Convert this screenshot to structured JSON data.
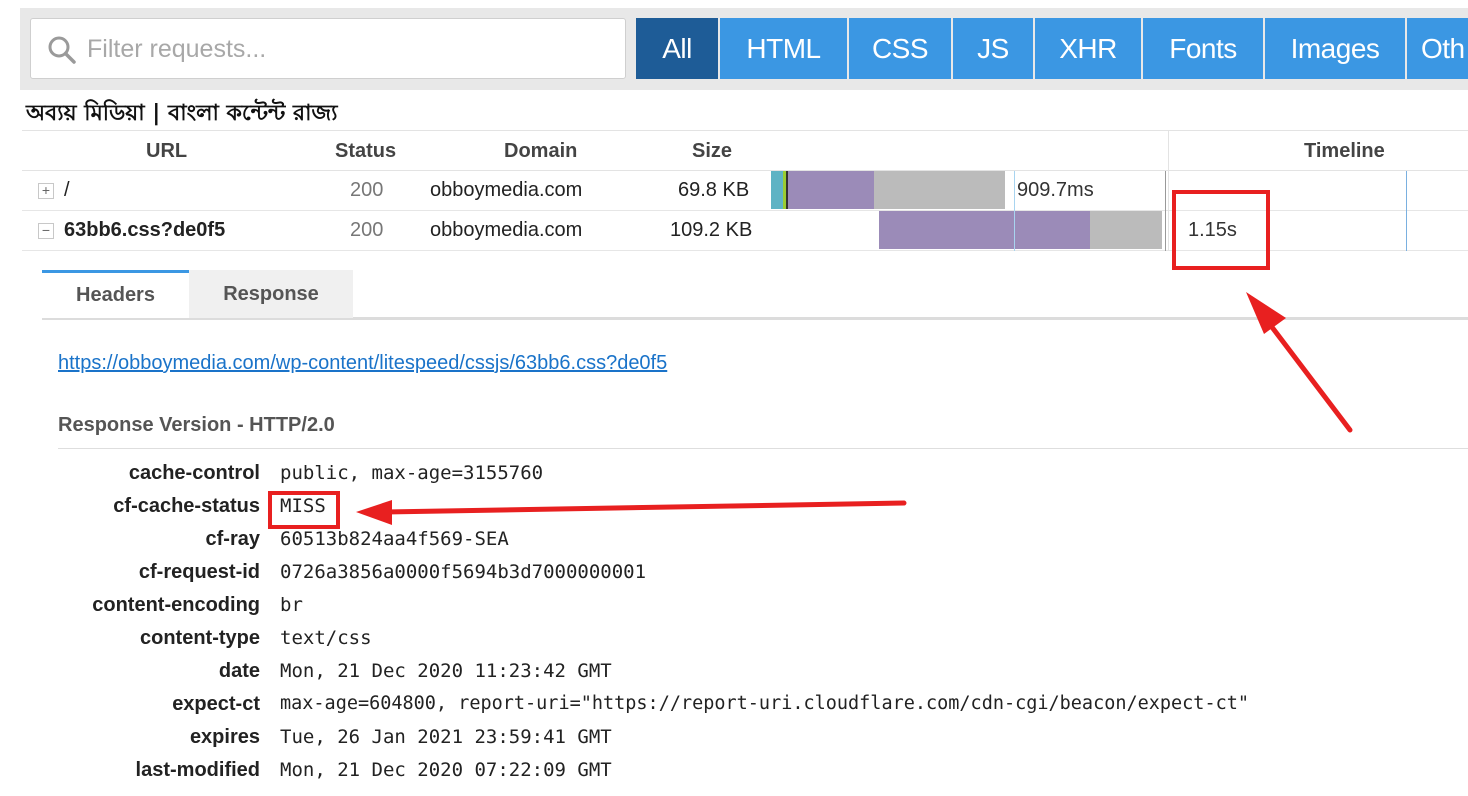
{
  "filter": {
    "placeholder": "Filter requests...",
    "search_icon": "search-icon",
    "types": [
      "All",
      "HTML",
      "CSS",
      "JS",
      "XHR",
      "Fonts",
      "Images",
      "Oth"
    ],
    "active_type": "All"
  },
  "page_title": "অব্যয় মিডিয়া | বাংলা কন্টেন্ট রাজ্য",
  "table": {
    "columns": {
      "url": "URL",
      "status": "Status",
      "domain": "Domain",
      "size": "Size",
      "timeline": "Timeline"
    },
    "rows": [
      {
        "toggle": "+",
        "url": "/",
        "status": "200",
        "domain": "obboymedia.com",
        "size": "69.8 KB",
        "time": "909.7ms"
      },
      {
        "toggle": "−",
        "url": "63bb6.css?de0f5",
        "status": "200",
        "domain": "obboymedia.com",
        "size": "109.2 KB",
        "time": "1.15s"
      }
    ]
  },
  "details": {
    "tabs": [
      "Headers",
      "Response"
    ],
    "active_tab": "Headers",
    "url": "https://obboymedia.com/wp-content/litespeed/cssjs/63bb6.css?de0f5",
    "response_version": "Response Version - HTTP/2.0",
    "headers": [
      {
        "name": "cache-control",
        "value": "public, max-age=3155760"
      },
      {
        "name": "cf-cache-status",
        "value": "MISS"
      },
      {
        "name": "cf-ray",
        "value": "60513b824aa4f569-SEA"
      },
      {
        "name": "cf-request-id",
        "value": "0726a3856a0000f5694b3d7000000001"
      },
      {
        "name": "content-encoding",
        "value": "br"
      },
      {
        "name": "content-type",
        "value": "text/css"
      },
      {
        "name": "date",
        "value": "Mon, 21 Dec 2020 11:23:42 GMT"
      },
      {
        "name": "expect-ct",
        "value": "max-age=604800, report-uri=\"https://report-uri.cloudflare.com/cdn-cgi/beacon/expect-ct\""
      },
      {
        "name": "expires",
        "value": "Tue, 26 Jan 2021 23:59:41 GMT"
      },
      {
        "name": "last-modified",
        "value": "Mon, 21 Dec 2020 07:22:09 GMT"
      }
    ]
  },
  "colors": {
    "accent": "#3b97e3",
    "active": "#1e5c97",
    "bar_purple": "#9b8bb8",
    "bar_gray": "#bbbbbb",
    "bar_teal": "#5eb3c4",
    "annotation": "#e82020"
  }
}
